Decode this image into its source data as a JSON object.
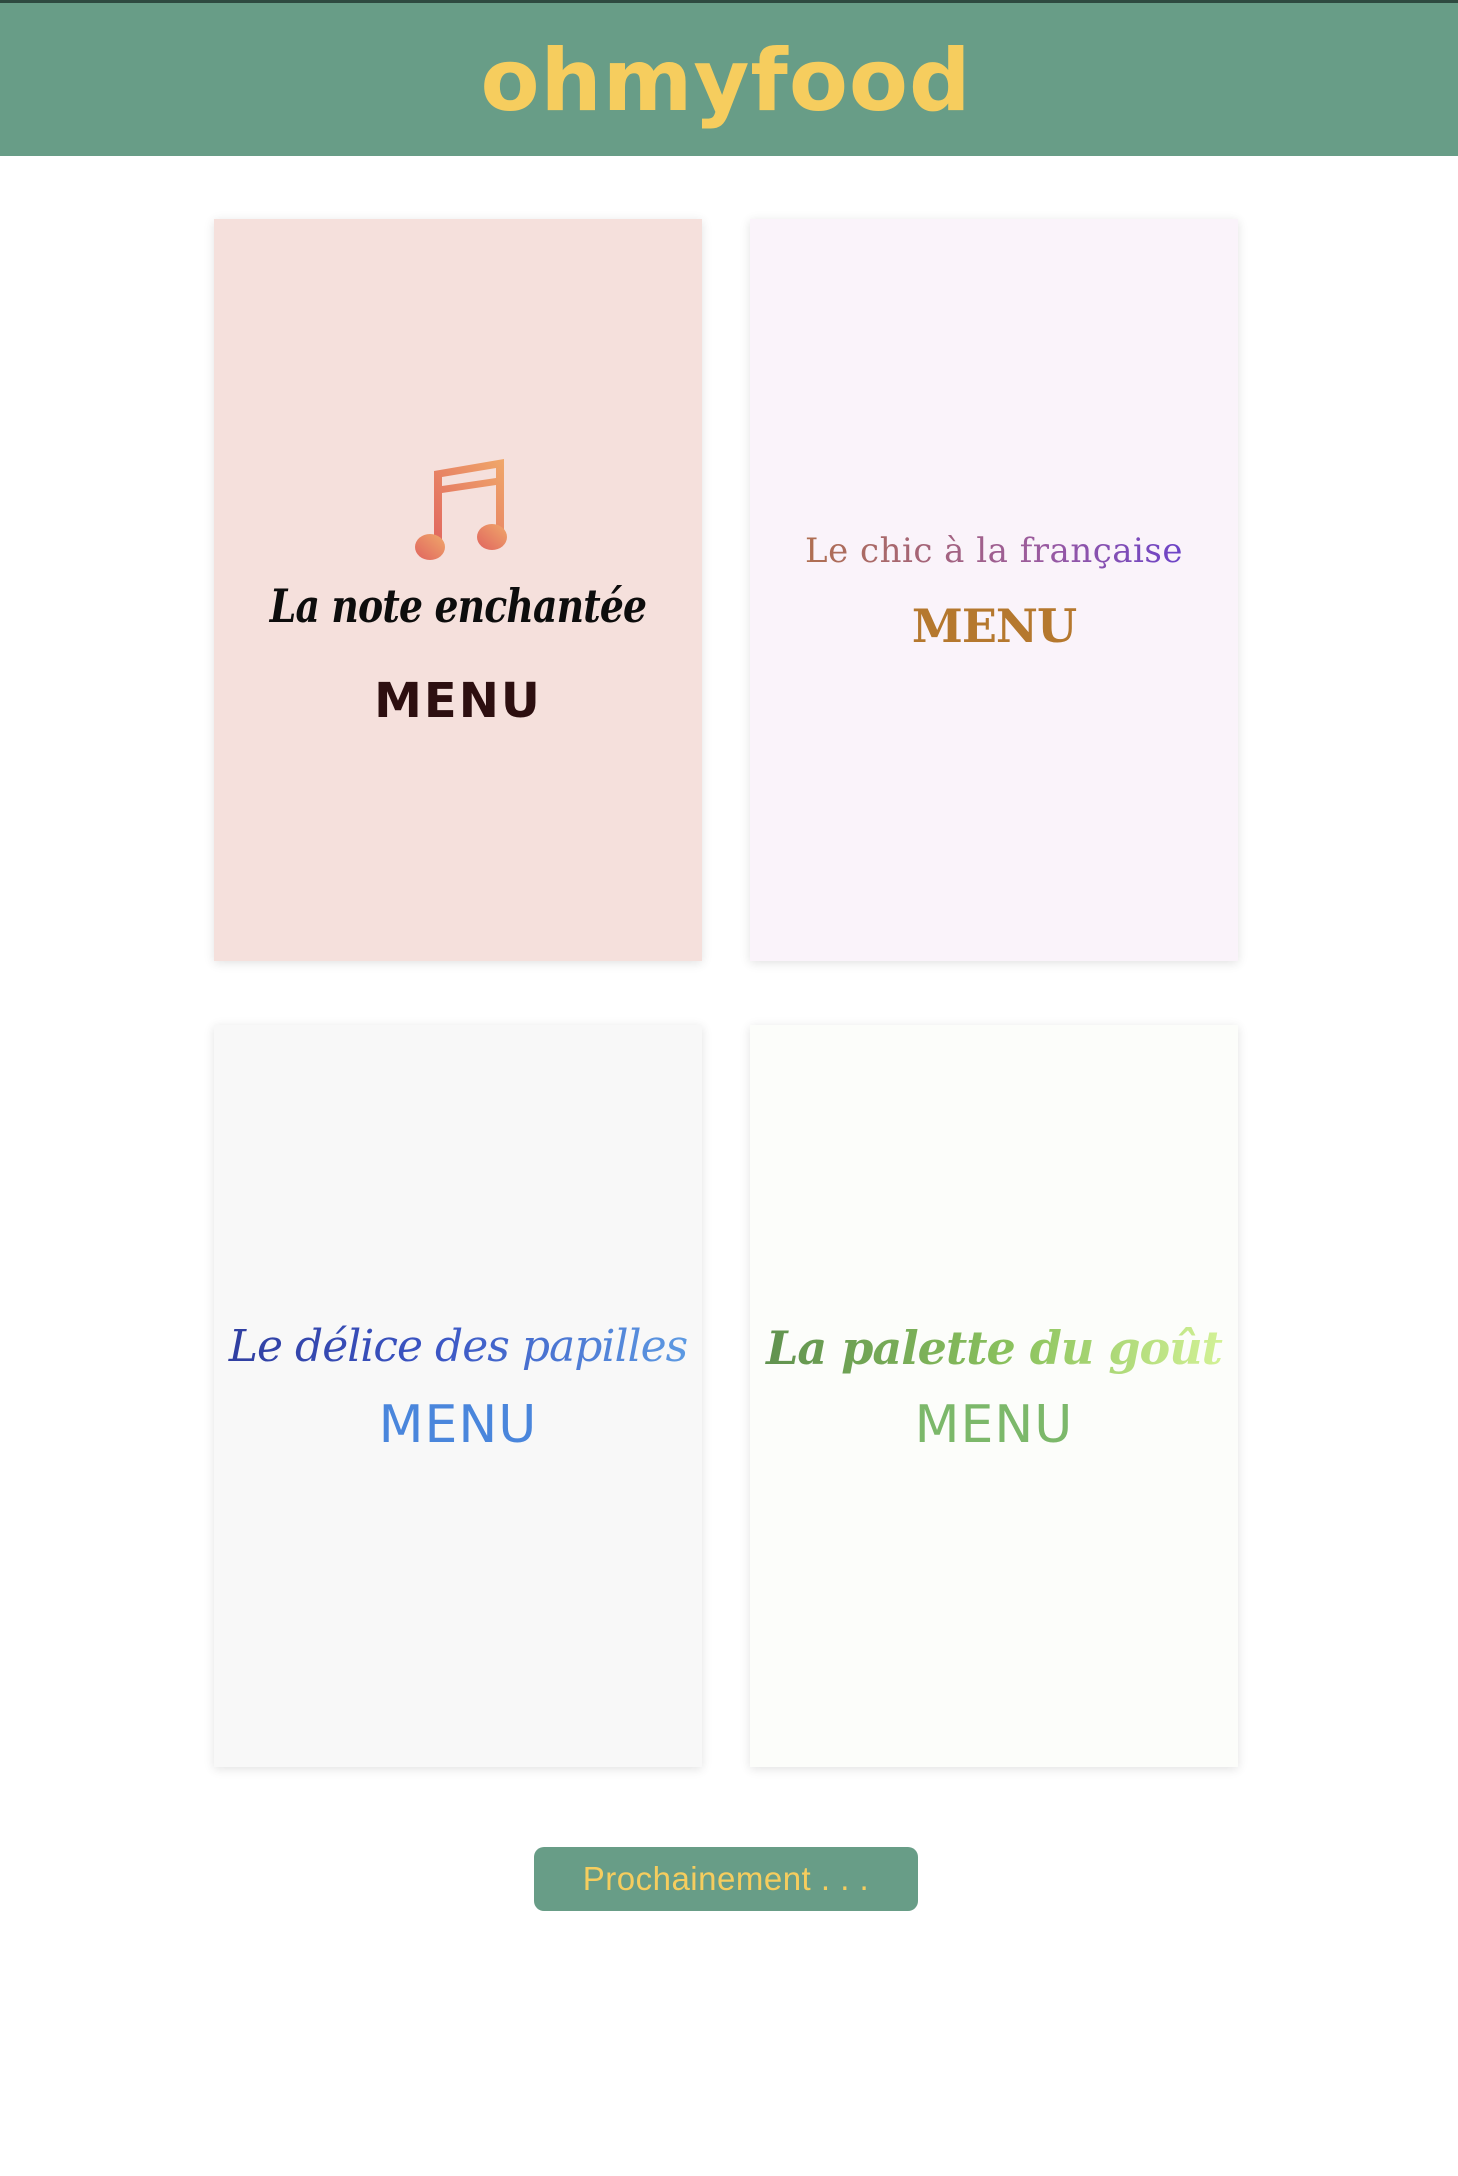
{
  "header": {
    "brand": "ohmyfood"
  },
  "restaurants": [
    {
      "name": "La note enchantée",
      "menu_label": "MENU",
      "icon": "music-note-icon"
    },
    {
      "name": "Le chic à la française",
      "menu_label": "MENU"
    },
    {
      "name": "Le délice des papilles",
      "menu_label": "MENU"
    },
    {
      "name": "La palette du goût",
      "menu_label": "MENU"
    }
  ],
  "footer": {
    "coming_soon_label": "Prochainement . . ."
  },
  "colors": {
    "header_bg": "#689d87",
    "brand": "#f6cd5e",
    "card1_bg": "#f5e0dc",
    "card2_bg": "#faf3fa",
    "card3_bg": "#f8f8f8",
    "card4_bg": "#fcfdfa"
  }
}
